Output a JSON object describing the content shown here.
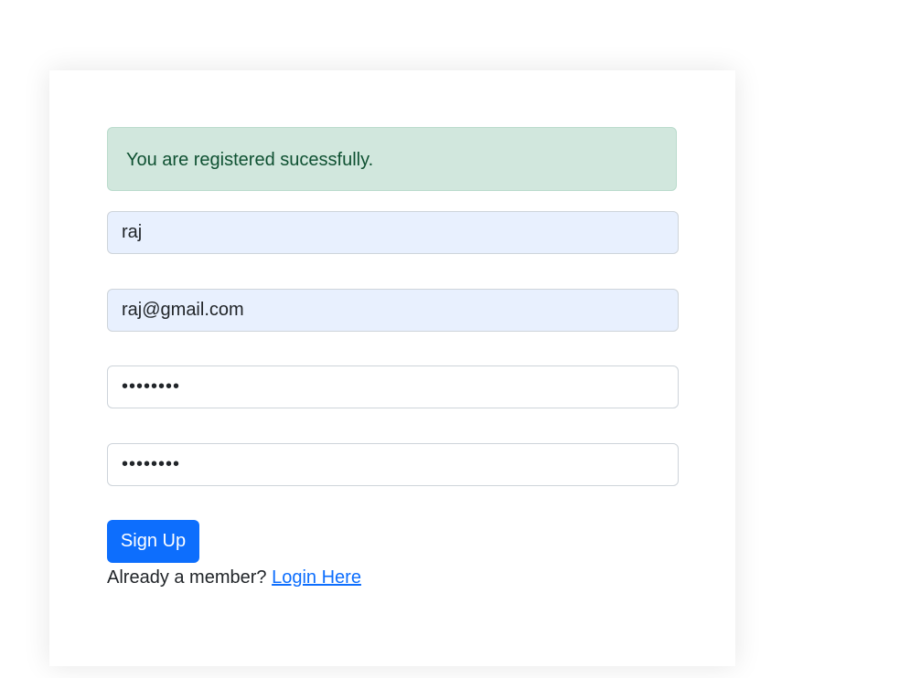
{
  "alert": {
    "message": "You are registered sucessfully.",
    "bg_color": "#d1e7dd",
    "text_color": "#0f5132"
  },
  "form": {
    "name_value": "raj",
    "email_value": "raj@gmail.com",
    "password_value": "••••••••",
    "confirm_password_value": "••••••••"
  },
  "signup_button": {
    "label": "Sign Up",
    "color": "#0d6efd"
  },
  "footer": {
    "prompt": "Already a member?",
    "login_link": "Login Here"
  }
}
